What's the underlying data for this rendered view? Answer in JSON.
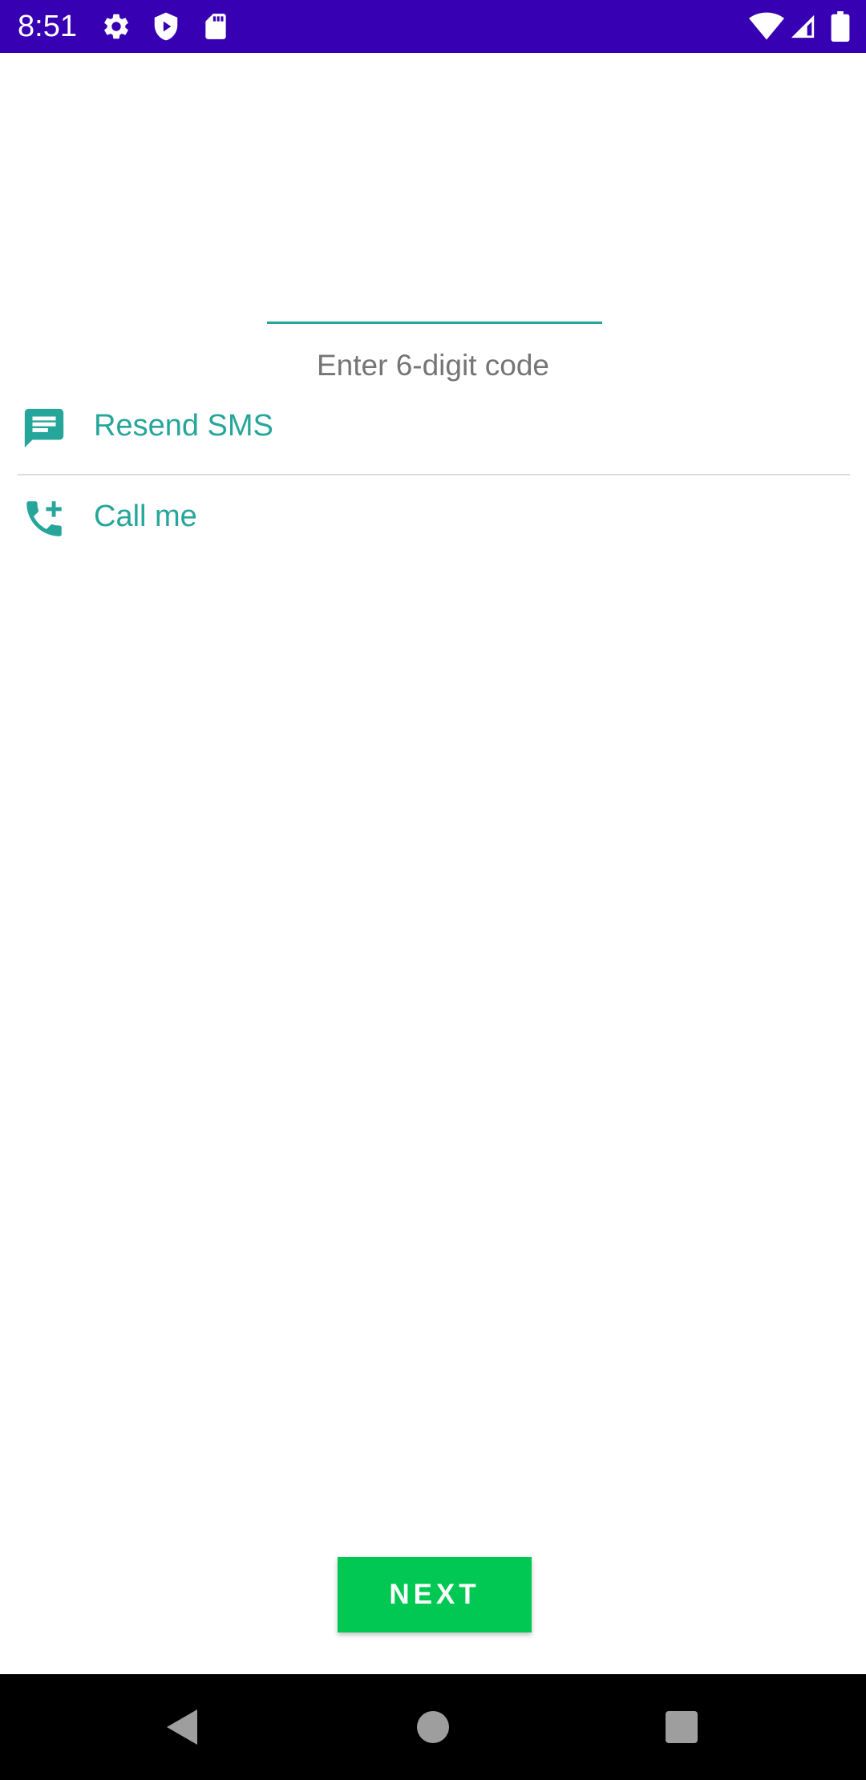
{
  "status_bar": {
    "time": "8:51",
    "background": "#3700b3",
    "left_icons": [
      "settings-icon",
      "play-protect-icon",
      "sd-card-icon"
    ],
    "right_icons": [
      "wifi-icon",
      "cell-signal-icon",
      "battery-icon"
    ]
  },
  "verification": {
    "code_value": "",
    "code_hint": "Enter 6-digit code",
    "accent_color": "#26a69a"
  },
  "options": [
    {
      "label": "Resend SMS",
      "icon": "message-icon"
    },
    {
      "label": "Call me",
      "icon": "add-call-icon"
    }
  ],
  "actions": {
    "next_label": "NEXT",
    "next_color": "#00c853"
  },
  "nav_bar": {
    "buttons": [
      "back-icon",
      "home-icon",
      "recents-icon"
    ]
  }
}
